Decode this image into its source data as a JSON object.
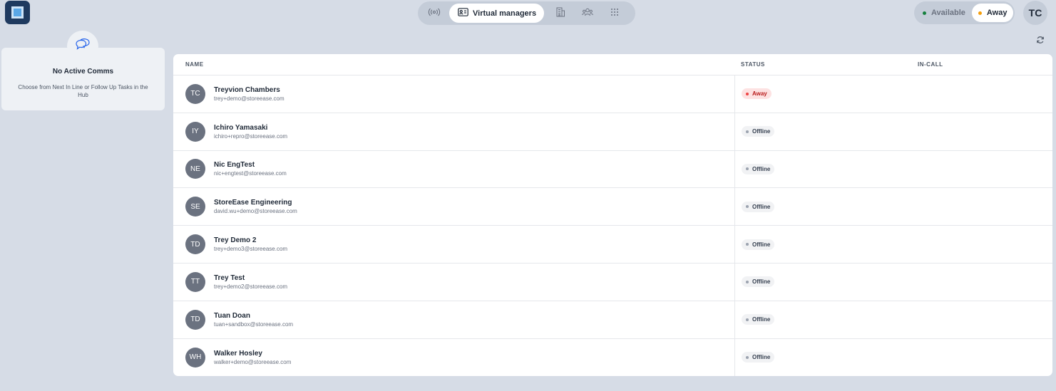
{
  "colors": {
    "background": "#d6dce6",
    "accent_available": "#15803d",
    "accent_away": "#f59e0b",
    "badge_away": "#b91c1c"
  },
  "nav": {
    "items": [
      {
        "icon": "broadcast-icon",
        "label": ""
      },
      {
        "icon": "contact-card-icon",
        "label": "Virtual managers",
        "active": true
      },
      {
        "icon": "building-icon",
        "label": ""
      },
      {
        "icon": "team-icon",
        "label": ""
      },
      {
        "icon": "dialpad-icon",
        "label": ""
      }
    ]
  },
  "presence": {
    "available_label": "Available",
    "away_label": "Away",
    "selected": "Away"
  },
  "user": {
    "initials": "TC"
  },
  "comms": {
    "title": "No Active Comms",
    "subtitle": "Choose from Next In Line or Follow Up Tasks in the Hub"
  },
  "table": {
    "columns": {
      "name": "NAME",
      "status": "STATUS",
      "in_call": "IN-CALL"
    },
    "rows": [
      {
        "initials": "TC",
        "name": "Treyvion Chambers",
        "email": "trey+demo@storeease.com",
        "status": "Away"
      },
      {
        "initials": "IY",
        "name": "Ichiro Yamasaki",
        "email": "ichiro+repro@storeease.com",
        "status": "Offline"
      },
      {
        "initials": "NE",
        "name": "Nic EngTest",
        "email": "nic+engtest@storeease.com",
        "status": "Offline"
      },
      {
        "initials": "SE",
        "name": "StoreEase Engineering",
        "email": "david.wu+demo@storeease.com",
        "status": "Offline"
      },
      {
        "initials": "TD",
        "name": "Trey Demo 2",
        "email": "trey+demo3@storeease.com",
        "status": "Offline"
      },
      {
        "initials": "TT",
        "name": "Trey Test",
        "email": "trey+demo2@storeease.com",
        "status": "Offline"
      },
      {
        "initials": "TD",
        "name": "Tuan Doan",
        "email": "tuan+sandbox@storeease.com",
        "status": "Offline"
      },
      {
        "initials": "WH",
        "name": "Walker Hosley",
        "email": "walker+demo@storeease.com",
        "status": "Offline"
      }
    ]
  }
}
